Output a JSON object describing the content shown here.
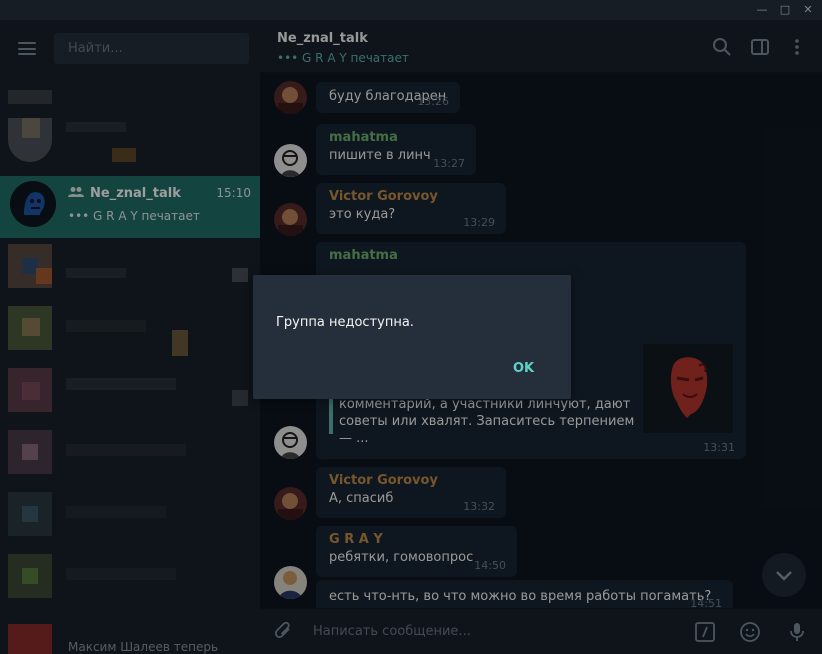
{
  "window": {
    "minimize_glyph": "—",
    "maximize_glyph": "□",
    "close_glyph": "✕"
  },
  "sidebar": {
    "search_placeholder": "Найти...",
    "active_chat": {
      "name": "Ne_znal_talk",
      "time": "15:10",
      "status": "••• G R A Y печатает"
    },
    "bottom_partial_text": "Максим Шалеев теперь"
  },
  "chat": {
    "header": {
      "title": "Ne_znal_talk",
      "status": "••• G R A Y печатает"
    },
    "messages": [
      {
        "author": "",
        "text": "буду благодарен",
        "time": "13:26"
      },
      {
        "author": "mahatma",
        "author_color": "#6fb370",
        "text": "пишите в линч",
        "time": "13:27"
      },
      {
        "author": "Victor Gorovoy",
        "author_color": "#c28c4a",
        "text": "это куда?",
        "time": "13:29"
      },
      {
        "author": "mahatma",
        "author_color": "#6fb370",
        "text": "комментарий, а участники линчуют, дают советы или хвалят. Запаситесь терпением — ...",
        "time": "13:31"
      },
      {
        "author": "Victor Gorovoy",
        "author_color": "#c28c4a",
        "text": "А, спасиб",
        "time": "13:32"
      },
      {
        "author": "G R A Y",
        "author_color": "#c28c4a",
        "text": "ребятки, гомовопрос",
        "time": "14:50"
      },
      {
        "author": "",
        "text": "есть что-нть, во что можно во время работы погамать?",
        "time": "14:51"
      }
    ],
    "composer_placeholder": "Написать сообщение..."
  },
  "dialog": {
    "message": "Группа недоступна.",
    "ok_label": "OK"
  },
  "colors": {
    "accent": "#1f6e67",
    "ok_text": "#5fd3c8",
    "typing": "#5fb3a8"
  }
}
